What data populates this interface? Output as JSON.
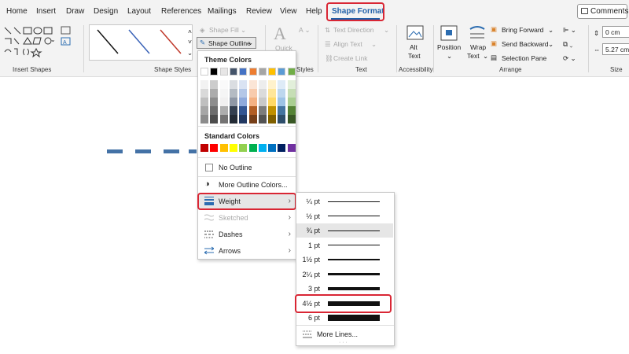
{
  "tabs": [
    "Home",
    "Insert",
    "Draw",
    "Design",
    "Layout",
    "References",
    "Mailings",
    "Review",
    "View",
    "Help",
    "Shape Format"
  ],
  "active_tab": "Shape Format",
  "comments_label": "Comments",
  "ribbon": {
    "groups": {
      "insert_shapes": "Insert Shapes",
      "shape_styles": "Shape Styles",
      "wordart": "Styles",
      "text": "Text",
      "accessibility": "Accessibility",
      "arrange": "Arrange",
      "size": "Size"
    },
    "shape_fill": "Shape Fill",
    "shape_outline": "Shape Outline",
    "quick_styles": "Quick",
    "text_direction": "Text Direction",
    "align_text": "Align Text",
    "create_link": "Create Link",
    "alt_text_1": "Alt",
    "alt_text_2": "Text",
    "position": "Position",
    "wrap_text_1": "Wrap",
    "wrap_text_2": "Text",
    "bring_forward": "Bring Forward",
    "send_backward": "Send Backward",
    "selection_pane": "Selection Pane",
    "height_value": "0 cm",
    "width_value": "5.27 cm"
  },
  "outline_menu": {
    "theme_colors_title": "Theme Colors",
    "standard_colors_title": "Standard Colors",
    "no_outline": "No Outline",
    "more_outline_colors": "More Outline Colors...",
    "weight": "Weight",
    "sketched": "Sketched",
    "dashes": "Dashes",
    "arrows": "Arrows",
    "theme_top_row": [
      "#ffffff",
      "#000000",
      "#e7e6e6",
      "#44546a",
      "#4472c4",
      "#ed7d31",
      "#a5a5a5",
      "#ffc000",
      "#5b9bd5",
      "#70ad47"
    ],
    "standard_colors": [
      "#c00000",
      "#ff0000",
      "#ffc000",
      "#ffff00",
      "#92d050",
      "#00b050",
      "#00b0f0",
      "#0070c0",
      "#002060",
      "#7030a0"
    ]
  },
  "weight_menu": {
    "options": [
      {
        "label": "¼ pt",
        "weight": 0.25
      },
      {
        "label": "½ pt",
        "weight": 0.5
      },
      {
        "label": "¾ pt",
        "weight": 0.75
      },
      {
        "label": "1 pt",
        "weight": 1
      },
      {
        "label": "1½ pt",
        "weight": 1.5
      },
      {
        "label": "2¼ pt",
        "weight": 2.25
      },
      {
        "label": "3 pt",
        "weight": 3
      },
      {
        "label": "4½ pt",
        "weight": 4.5
      },
      {
        "label": "6 pt",
        "weight": 6
      }
    ],
    "selected": "4½ pt",
    "more_lines": "More Lines..."
  }
}
